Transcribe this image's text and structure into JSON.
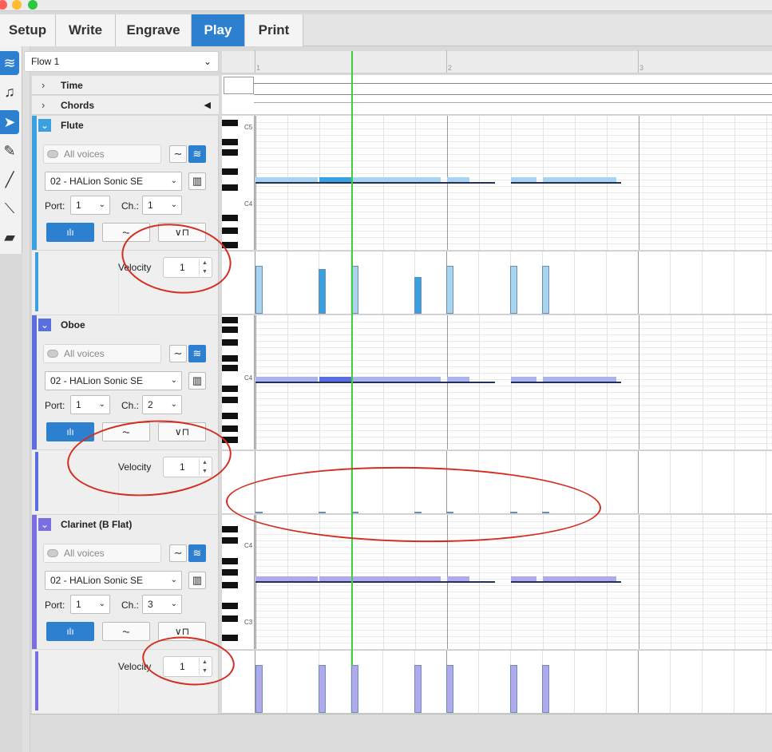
{
  "tabs": [
    {
      "label": "Setup"
    },
    {
      "label": "Write"
    },
    {
      "label": "Engrave"
    },
    {
      "label": "Play"
    },
    {
      "label": "Print"
    }
  ],
  "active_tab": "Play",
  "flow": {
    "selected": "Flow 1"
  },
  "ruler": {
    "bars": [
      "1",
      "2",
      "3"
    ]
  },
  "global_tracks": {
    "time": "Time",
    "chords": "Chords"
  },
  "instruments": [
    {
      "name": "Flute",
      "voices": "All voices",
      "device": "02 - HALion Sonic SE",
      "port_label": "Port:",
      "port": "1",
      "channel_label": "Ch.:",
      "channel": "1",
      "velocity_label": "Velocity",
      "velocity": "1",
      "key_labels": [
        "C5",
        "C4"
      ]
    },
    {
      "name": "Oboe",
      "voices": "All voices",
      "device": "02 - HALion Sonic SE",
      "port_label": "Port:",
      "port": "1",
      "channel_label": "Ch.:",
      "channel": "2",
      "velocity_label": "Velocity",
      "velocity": "1",
      "key_labels": [
        "C4"
      ]
    },
    {
      "name": "Clarinet (B Flat)",
      "voices": "All voices",
      "device": "02 - HALion Sonic SE",
      "port_label": "Port:",
      "port": "1",
      "channel_label": "Ch.:",
      "channel": "3",
      "velocity_label": "Velocity",
      "velocity": "1",
      "key_labels": [
        "C4",
        "C3"
      ]
    }
  ],
  "colors": {
    "accent": "#2d7fd0",
    "flute": "#3aa0e0",
    "oboe": "#5b6ee0",
    "clarinet": "#7a6ee0",
    "playhead": "#3fce3f",
    "annotation": "#d32d1f"
  },
  "icons": {
    "tools": [
      "waveform-icon",
      "note-icon",
      "pointer-icon",
      "pencil-icon",
      "line-icon",
      "line-tool-icon",
      "eraser-icon"
    ]
  }
}
